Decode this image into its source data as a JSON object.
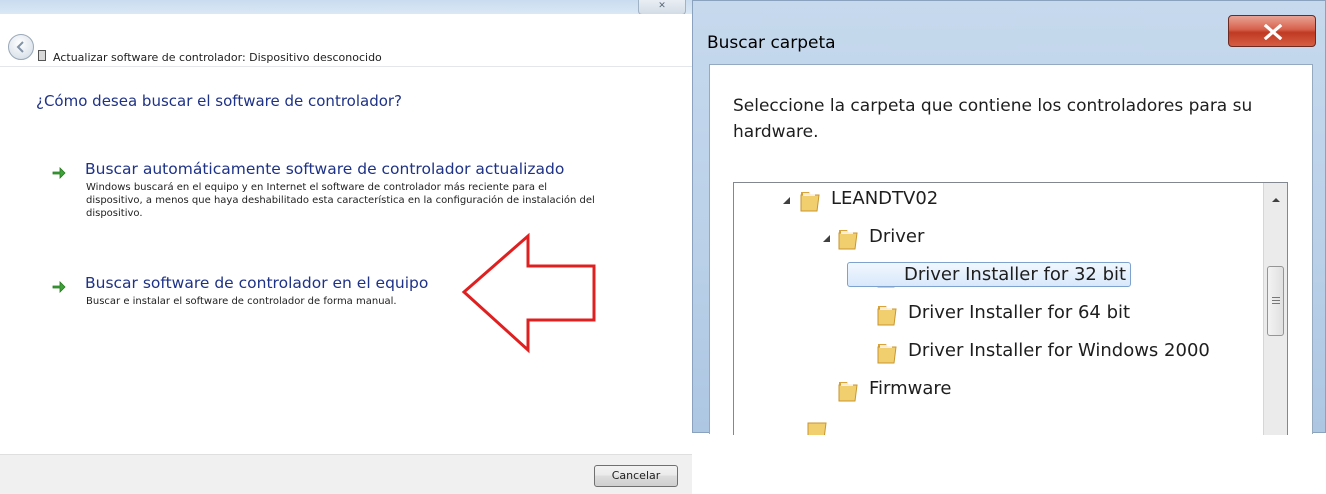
{
  "left_window": {
    "title": "Actualizar software de controlador: Dispositivo desconocido",
    "close_glyph": "✕",
    "question": "¿Cómo desea buscar el software de controlador?",
    "options": [
      {
        "title": "Buscar automáticamente software de controlador actualizado",
        "description": "Windows buscará en el equipo y en Internet el software de controlador más reciente para el dispositivo, a menos que haya deshabilitado esta característica en la configuración de instalación del dispositivo.",
        "icon": "green-arrow-icon"
      },
      {
        "title": "Buscar software de controlador en el equipo",
        "description": "Buscar e instalar el software de controlador de forma manual.",
        "icon": "green-arrow-icon"
      }
    ],
    "cancel_label": "Cancelar",
    "annotation": {
      "icon": "red-outline-arrow-icon",
      "color": "#e02020"
    }
  },
  "right_window": {
    "title": "Buscar carpeta",
    "instruction": "Seleccione la carpeta que contiene los controladores para su hardware.",
    "tree": [
      {
        "label": "LEANDTV02",
        "expanded": true
      },
      {
        "label": "Driver",
        "expanded": true
      },
      {
        "label": "Driver Installer for 32 bit",
        "selected": true
      },
      {
        "label": "Driver Installer for 64 bit"
      },
      {
        "label": "Driver Installer for Windows 2000"
      },
      {
        "label": "Firmware"
      }
    ]
  },
  "colors": {
    "link_blue": "#1e3287",
    "close_red": "#c03a23",
    "folder_yellow": "#e8b84a",
    "selection_border": "#7da2ce"
  }
}
